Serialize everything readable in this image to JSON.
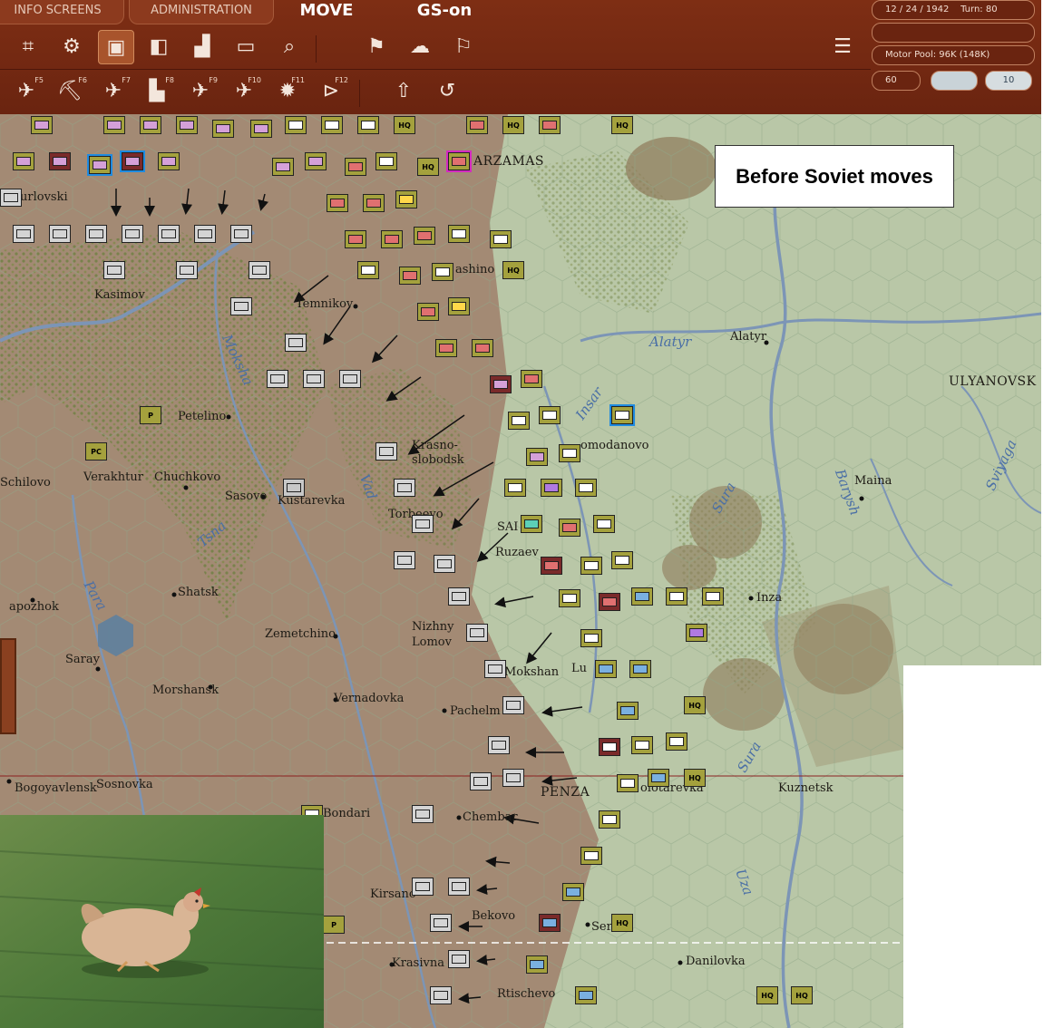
{
  "topbar": {
    "tabs": [
      "INFO SCREENS",
      "ADMINISTRATION"
    ],
    "mode": "MOVE",
    "side": "GS-on",
    "status": {
      "date": "12 / 24 / 1942",
      "turn": "Turn: 80",
      "motor_pool": "Motor Pool:  96K (148K)",
      "value": "60",
      "counter": "10"
    },
    "fkeys": [
      "F5",
      "F6",
      "F7",
      "F8",
      "F9",
      "F10",
      "F11",
      "F12"
    ]
  },
  "annotation": "Before Soviet moves",
  "cities": [
    {
      "name": "ARZAMAS",
      "cls": "big"
    },
    {
      "name": "urlovski"
    },
    {
      "name": "Kasimov"
    },
    {
      "name": "Temnikov"
    },
    {
      "name": "ashino"
    },
    {
      "name": "Alatyr"
    },
    {
      "name": "ULYANOVSK",
      "cls": "big"
    },
    {
      "name": "Petelino"
    },
    {
      "name": "Krasno-"
    },
    {
      "name": "slobodsk"
    },
    {
      "name": "omodanovo"
    },
    {
      "name": "Verakhtur"
    },
    {
      "name": "Chuchkovo"
    },
    {
      "name": "Sasovo"
    },
    {
      "name": "Kustarevka"
    },
    {
      "name": "Maina"
    },
    {
      "name": "Torbeevo"
    },
    {
      "name": "SAI"
    },
    {
      "name": "Ruzaev"
    },
    {
      "name": "Shatsk"
    },
    {
      "name": "Inza"
    },
    {
      "name": "apozhok"
    },
    {
      "name": "Zemetchino"
    },
    {
      "name": "Nizhny"
    },
    {
      "name": "Lomov"
    },
    {
      "name": "Saray"
    },
    {
      "name": "Mokshan"
    },
    {
      "name": "Lu"
    },
    {
      "name": "Morshansk"
    },
    {
      "name": "Vernadovka"
    },
    {
      "name": "Pachelm"
    },
    {
      "name": "PENZA",
      "cls": "big"
    },
    {
      "name": "olotarevka"
    },
    {
      "name": "Kuznetsk"
    },
    {
      "name": "Bogoyavlensk"
    },
    {
      "name": "Sosnovka"
    },
    {
      "name": "Bondari"
    },
    {
      "name": "Chembar"
    },
    {
      "name": "Kirsano"
    },
    {
      "name": "Bekovo"
    },
    {
      "name": "Ser"
    },
    {
      "name": "Krasivna"
    },
    {
      "name": "Danilovka"
    },
    {
      "name": "Rtischevo"
    },
    {
      "name": "Schilovo"
    }
  ],
  "rivers": [
    "Alatyr",
    "Insar",
    "Moksha",
    "Vad",
    "Tsna",
    "Para",
    "Sura",
    "Barysh",
    "Sviyaga",
    "Uza"
  ],
  "map_markers": [
    "P",
    "PC",
    "HQ"
  ]
}
